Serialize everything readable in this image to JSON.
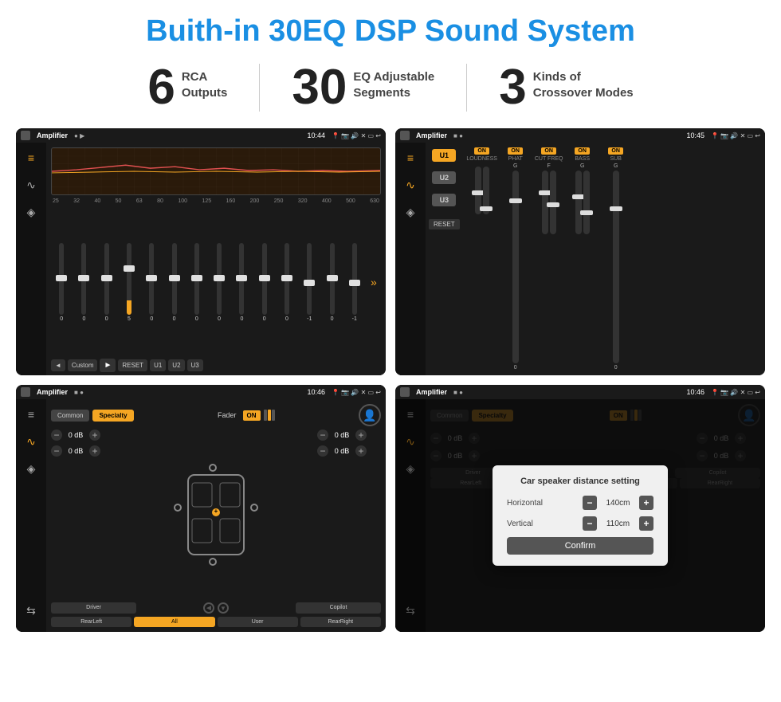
{
  "page": {
    "title": "Buith-in 30EQ DSP Sound System",
    "stats": [
      {
        "number": "6",
        "label": "RCA\nOutputs"
      },
      {
        "number": "30",
        "label": "EQ Adjustable\nSegments"
      },
      {
        "number": "3",
        "label": "Kinds of\nCrossover Modes"
      }
    ],
    "screens": [
      {
        "id": "screen1",
        "app": "Amplifier",
        "time": "10:44",
        "type": "eq"
      },
      {
        "id": "screen2",
        "app": "Amplifier",
        "time": "10:45",
        "type": "crossover"
      },
      {
        "id": "screen3",
        "app": "Amplifier",
        "time": "10:46",
        "type": "fader"
      },
      {
        "id": "screen4",
        "app": "Amplifier",
        "time": "10:46",
        "type": "dialog"
      }
    ],
    "eq": {
      "frequencies": [
        "25",
        "32",
        "40",
        "50",
        "63",
        "80",
        "100",
        "125",
        "160",
        "200",
        "250",
        "320",
        "400",
        "500",
        "630"
      ],
      "values": [
        "0",
        "0",
        "0",
        "5",
        "0",
        "0",
        "0",
        "0",
        "0",
        "0",
        "0",
        "-1",
        "0",
        "-1"
      ],
      "buttons": [
        "◄",
        "Custom",
        "►",
        "RESET",
        "U1",
        "U2",
        "U3"
      ]
    },
    "crossover": {
      "u_buttons": [
        "U1",
        "U2",
        "U3"
      ],
      "controls": [
        "LOUDNESS",
        "PHAT",
        "CUT FREQ",
        "BASS",
        "SUB"
      ],
      "reset": "RESET"
    },
    "fader": {
      "tabs": [
        "Common",
        "Specialty"
      ],
      "fader_label": "Fader",
      "on_label": "ON",
      "db_rows": [
        [
          "0 dB",
          "0 dB"
        ],
        [
          "0 dB",
          "0 dB"
        ]
      ],
      "bottom_btns": [
        "Driver",
        "",
        "Copilot",
        "RearLeft",
        "All",
        "User",
        "RearRight"
      ]
    },
    "dialog": {
      "title": "Car speaker distance setting",
      "horizontal_label": "Horizontal",
      "horizontal_value": "140cm",
      "vertical_label": "Vertical",
      "vertical_value": "110cm",
      "confirm_label": "Confirm",
      "minus_label": "−",
      "plus_label": "+"
    }
  }
}
